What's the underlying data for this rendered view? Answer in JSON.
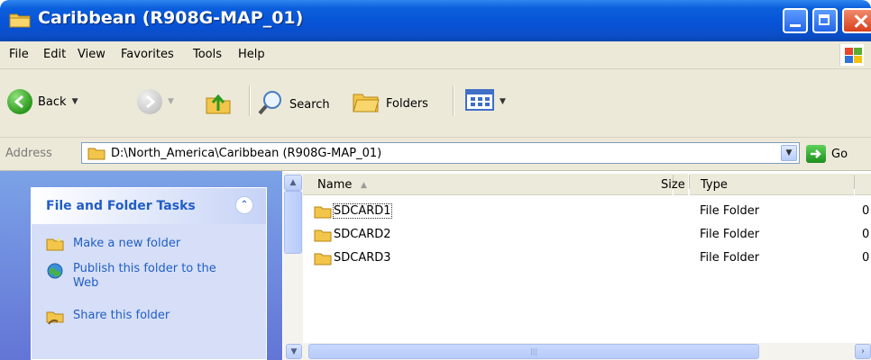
{
  "window": {
    "title": "Caribbean (R908G-MAP_01)"
  },
  "menu": [
    "File",
    "Edit",
    "View",
    "Favorites",
    "Tools",
    "Help"
  ],
  "toolbar": {
    "back": "Back",
    "search": "Search",
    "folders": "Folders"
  },
  "address": {
    "label": "Address",
    "path": "D:\\North_America\\Caribbean (R908G-MAP_01)",
    "go": "Go"
  },
  "tasks": {
    "title": "File and Folder Tasks",
    "items": [
      "Make a new folder",
      "Publish this folder to the Web",
      "Share this folder"
    ]
  },
  "list": {
    "columns": [
      "Name",
      "Size",
      "Type"
    ],
    "rows": [
      {
        "name": "SDCARD1",
        "type": "File Folder",
        "date": "0"
      },
      {
        "name": "SDCARD2",
        "type": "File Folder",
        "date": "0"
      },
      {
        "name": "SDCARD3",
        "type": "File Folder",
        "date": "0"
      }
    ]
  },
  "colors": {
    "titlebar": "#0752d6",
    "task_link": "#215dc6",
    "pane": "#6375d6"
  }
}
